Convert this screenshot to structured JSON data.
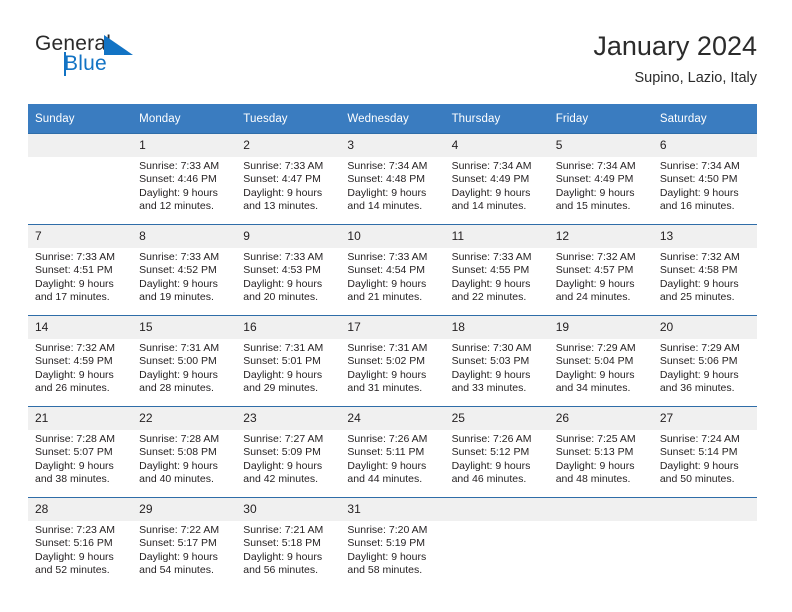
{
  "brand": {
    "name_top": "General",
    "name_bottom": "Blue",
    "logo_icon": "triangle-logo-icon",
    "color_blue": "#1273c4",
    "color_dark": "#2b2b2b"
  },
  "header": {
    "title": "January 2024",
    "subtitle": "Supino, Lazio, Italy"
  },
  "theme": {
    "header_blue": "#3a7cc0",
    "row_divider": "#2f6da8",
    "daynum_band": "#f0f0f0"
  },
  "calendar": {
    "weekday_headers": [
      "Sunday",
      "Monday",
      "Tuesday",
      "Wednesday",
      "Thursday",
      "Friday",
      "Saturday"
    ],
    "weeks": [
      [
        {
          "day": "",
          "sunrise": "",
          "sunset": "",
          "daylight_line1": "",
          "daylight_line2": ""
        },
        {
          "day": "1",
          "sunrise": "Sunrise: 7:33 AM",
          "sunset": "Sunset: 4:46 PM",
          "daylight_line1": "Daylight: 9 hours",
          "daylight_line2": "and 12 minutes."
        },
        {
          "day": "2",
          "sunrise": "Sunrise: 7:33 AM",
          "sunset": "Sunset: 4:47 PM",
          "daylight_line1": "Daylight: 9 hours",
          "daylight_line2": "and 13 minutes."
        },
        {
          "day": "3",
          "sunrise": "Sunrise: 7:34 AM",
          "sunset": "Sunset: 4:48 PM",
          "daylight_line1": "Daylight: 9 hours",
          "daylight_line2": "and 14 minutes."
        },
        {
          "day": "4",
          "sunrise": "Sunrise: 7:34 AM",
          "sunset": "Sunset: 4:49 PM",
          "daylight_line1": "Daylight: 9 hours",
          "daylight_line2": "and 14 minutes."
        },
        {
          "day": "5",
          "sunrise": "Sunrise: 7:34 AM",
          "sunset": "Sunset: 4:49 PM",
          "daylight_line1": "Daylight: 9 hours",
          "daylight_line2": "and 15 minutes."
        },
        {
          "day": "6",
          "sunrise": "Sunrise: 7:34 AM",
          "sunset": "Sunset: 4:50 PM",
          "daylight_line1": "Daylight: 9 hours",
          "daylight_line2": "and 16 minutes."
        }
      ],
      [
        {
          "day": "7",
          "sunrise": "Sunrise: 7:33 AM",
          "sunset": "Sunset: 4:51 PM",
          "daylight_line1": "Daylight: 9 hours",
          "daylight_line2": "and 17 minutes."
        },
        {
          "day": "8",
          "sunrise": "Sunrise: 7:33 AM",
          "sunset": "Sunset: 4:52 PM",
          "daylight_line1": "Daylight: 9 hours",
          "daylight_line2": "and 19 minutes."
        },
        {
          "day": "9",
          "sunrise": "Sunrise: 7:33 AM",
          "sunset": "Sunset: 4:53 PM",
          "daylight_line1": "Daylight: 9 hours",
          "daylight_line2": "and 20 minutes."
        },
        {
          "day": "10",
          "sunrise": "Sunrise: 7:33 AM",
          "sunset": "Sunset: 4:54 PM",
          "daylight_line1": "Daylight: 9 hours",
          "daylight_line2": "and 21 minutes."
        },
        {
          "day": "11",
          "sunrise": "Sunrise: 7:33 AM",
          "sunset": "Sunset: 4:55 PM",
          "daylight_line1": "Daylight: 9 hours",
          "daylight_line2": "and 22 minutes."
        },
        {
          "day": "12",
          "sunrise": "Sunrise: 7:32 AM",
          "sunset": "Sunset: 4:57 PM",
          "daylight_line1": "Daylight: 9 hours",
          "daylight_line2": "and 24 minutes."
        },
        {
          "day": "13",
          "sunrise": "Sunrise: 7:32 AM",
          "sunset": "Sunset: 4:58 PM",
          "daylight_line1": "Daylight: 9 hours",
          "daylight_line2": "and 25 minutes."
        }
      ],
      [
        {
          "day": "14",
          "sunrise": "Sunrise: 7:32 AM",
          "sunset": "Sunset: 4:59 PM",
          "daylight_line1": "Daylight: 9 hours",
          "daylight_line2": "and 26 minutes."
        },
        {
          "day": "15",
          "sunrise": "Sunrise: 7:31 AM",
          "sunset": "Sunset: 5:00 PM",
          "daylight_line1": "Daylight: 9 hours",
          "daylight_line2": "and 28 minutes."
        },
        {
          "day": "16",
          "sunrise": "Sunrise: 7:31 AM",
          "sunset": "Sunset: 5:01 PM",
          "daylight_line1": "Daylight: 9 hours",
          "daylight_line2": "and 29 minutes."
        },
        {
          "day": "17",
          "sunrise": "Sunrise: 7:31 AM",
          "sunset": "Sunset: 5:02 PM",
          "daylight_line1": "Daylight: 9 hours",
          "daylight_line2": "and 31 minutes."
        },
        {
          "day": "18",
          "sunrise": "Sunrise: 7:30 AM",
          "sunset": "Sunset: 5:03 PM",
          "daylight_line1": "Daylight: 9 hours",
          "daylight_line2": "and 33 minutes."
        },
        {
          "day": "19",
          "sunrise": "Sunrise: 7:29 AM",
          "sunset": "Sunset: 5:04 PM",
          "daylight_line1": "Daylight: 9 hours",
          "daylight_line2": "and 34 minutes."
        },
        {
          "day": "20",
          "sunrise": "Sunrise: 7:29 AM",
          "sunset": "Sunset: 5:06 PM",
          "daylight_line1": "Daylight: 9 hours",
          "daylight_line2": "and 36 minutes."
        }
      ],
      [
        {
          "day": "21",
          "sunrise": "Sunrise: 7:28 AM",
          "sunset": "Sunset: 5:07 PM",
          "daylight_line1": "Daylight: 9 hours",
          "daylight_line2": "and 38 minutes."
        },
        {
          "day": "22",
          "sunrise": "Sunrise: 7:28 AM",
          "sunset": "Sunset: 5:08 PM",
          "daylight_line1": "Daylight: 9 hours",
          "daylight_line2": "and 40 minutes."
        },
        {
          "day": "23",
          "sunrise": "Sunrise: 7:27 AM",
          "sunset": "Sunset: 5:09 PM",
          "daylight_line1": "Daylight: 9 hours",
          "daylight_line2": "and 42 minutes."
        },
        {
          "day": "24",
          "sunrise": "Sunrise: 7:26 AM",
          "sunset": "Sunset: 5:11 PM",
          "daylight_line1": "Daylight: 9 hours",
          "daylight_line2": "and 44 minutes."
        },
        {
          "day": "25",
          "sunrise": "Sunrise: 7:26 AM",
          "sunset": "Sunset: 5:12 PM",
          "daylight_line1": "Daylight: 9 hours",
          "daylight_line2": "and 46 minutes."
        },
        {
          "day": "26",
          "sunrise": "Sunrise: 7:25 AM",
          "sunset": "Sunset: 5:13 PM",
          "daylight_line1": "Daylight: 9 hours",
          "daylight_line2": "and 48 minutes."
        },
        {
          "day": "27",
          "sunrise": "Sunrise: 7:24 AM",
          "sunset": "Sunset: 5:14 PM",
          "daylight_line1": "Daylight: 9 hours",
          "daylight_line2": "and 50 minutes."
        }
      ],
      [
        {
          "day": "28",
          "sunrise": "Sunrise: 7:23 AM",
          "sunset": "Sunset: 5:16 PM",
          "daylight_line1": "Daylight: 9 hours",
          "daylight_line2": "and 52 minutes."
        },
        {
          "day": "29",
          "sunrise": "Sunrise: 7:22 AM",
          "sunset": "Sunset: 5:17 PM",
          "daylight_line1": "Daylight: 9 hours",
          "daylight_line2": "and 54 minutes."
        },
        {
          "day": "30",
          "sunrise": "Sunrise: 7:21 AM",
          "sunset": "Sunset: 5:18 PM",
          "daylight_line1": "Daylight: 9 hours",
          "daylight_line2": "and 56 minutes."
        },
        {
          "day": "31",
          "sunrise": "Sunrise: 7:20 AM",
          "sunset": "Sunset: 5:19 PM",
          "daylight_line1": "Daylight: 9 hours",
          "daylight_line2": "and 58 minutes."
        },
        {
          "day": "",
          "sunrise": "",
          "sunset": "",
          "daylight_line1": "",
          "daylight_line2": ""
        },
        {
          "day": "",
          "sunrise": "",
          "sunset": "",
          "daylight_line1": "",
          "daylight_line2": ""
        },
        {
          "day": "",
          "sunrise": "",
          "sunset": "",
          "daylight_line1": "",
          "daylight_line2": ""
        }
      ]
    ]
  }
}
